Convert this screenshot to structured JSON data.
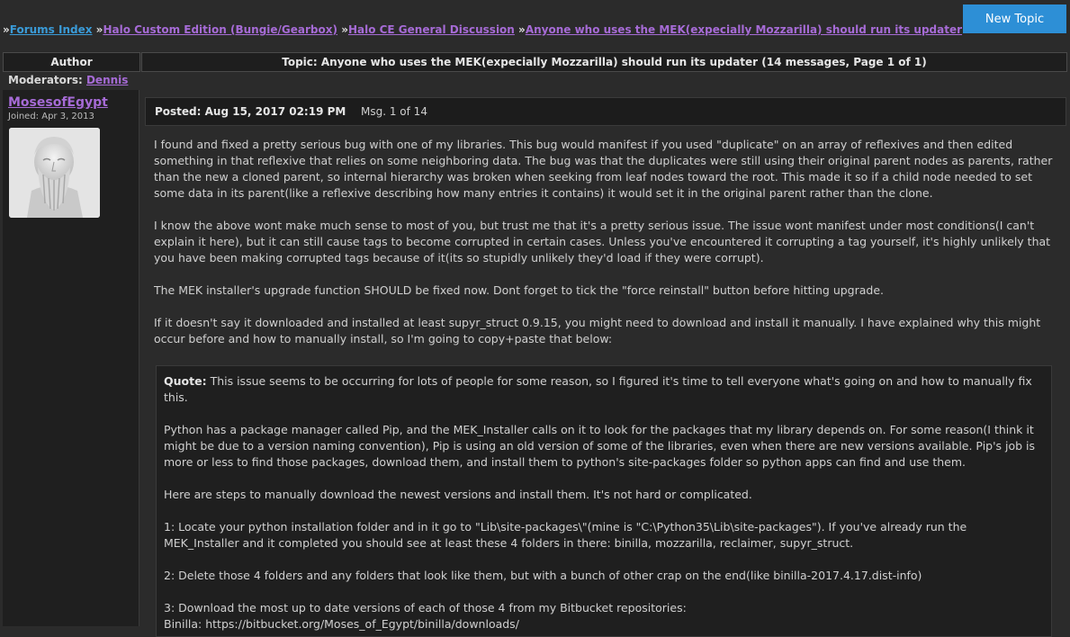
{
  "breadcrumb": {
    "items": [
      "Forums Index",
      "Halo Custom Edition (Bungie/Gearbox)",
      "Halo CE General Discussion",
      "Anyone who uses the MEK(expecially Mozzarilla) should run its updater"
    ],
    "separator": "»"
  },
  "new_topic_label": "New Topic",
  "table_header": {
    "author": "Author",
    "topic": "Topic: Anyone who uses the MEK(expecially Mozzarilla) should run its updater (14 messages, Page 1 of 1)"
  },
  "moderators": {
    "label": "Moderators:",
    "name": "Dennis"
  },
  "author": {
    "username": "MosesofEgypt",
    "joined": "Joined: Apr 3, 2013",
    "avatar": "bearded-statue-avatar"
  },
  "post": {
    "posted": "Posted: Aug 15, 2017 02:19 PM",
    "msg": "Msg. 1 of 14",
    "paragraphs": [
      "I found and fixed a pretty serious bug with one of my libraries. This bug would manifest if you used \"duplicate\" on an array of reflexives and then edited something in that reflexive that relies on some neighboring data. The bug was that the duplicates were still using their original parent nodes as parents, rather than the new a cloned parent, so internal hierarchy was broken when seeking from leaf nodes toward the root. This made it so if a child node needed to set some data in its parent(like a reflexive describing how many entries it contains) it would set it in the original parent rather than the clone.",
      "I know the above wont make much sense to most of you, but trust me that it's a pretty serious issue. The issue wont manifest under most conditions(I can't explain it here), but it can still cause tags to become corrupted in certain cases. Unless you've encountered it corrupting a tag yourself, it's highly unlikely that you have been making corrupted tags because of it(its so stupidly unlikely they'd load if they were corrupt).",
      "The MEK installer's upgrade function SHOULD be fixed now. Dont forget to tick the \"force reinstall\" button before hitting upgrade.",
      "If it doesn't say it downloaded and installed at least supyr_struct 0.9.15, you might need to download and install it manually. I have explained why this might occur before and how to manually install, so I'm going to copy+paste that below:"
    ],
    "quote": {
      "label": "Quote:",
      "first": "This issue seems to be occurring for lots of people for some reason, so I figured it's time to tell everyone what's going on and how to manually fix this.",
      "paragraphs": [
        "Python has a package manager called Pip, and the MEK_Installer calls on it to look for the packages that my library depends on. For some reason(I think it might be due to a version naming convention), Pip is using an old version of some of the libraries, even when there are new versions available. Pip's job is more or less to find those packages, download them, and install them to python's site-packages folder so python apps can find and use them.",
        "Here are steps to manually download the newest versions and install them. It's not hard or complicated.",
        "1: Locate your python installation folder and in it go to \"Lib\\site-packages\\\"(mine is \"C:\\Python35\\Lib\\site-packages\"). If you've already run the MEK_Installer and it completed you should see at least these 4 folders in there: binilla, mozzarilla, reclaimer, supyr_struct.",
        "2: Delete those 4 folders and any folders that look like them, but with a bunch of other crap on the end(like binilla-2017.4.17.dist-info)",
        "3: Download the most up to date versions of each of those 4 from my Bitbucket repositories:"
      ],
      "link_line": "Binilla: https://bitbucket.org/Moses_of_Egypt/binilla/downloads/"
    }
  }
}
